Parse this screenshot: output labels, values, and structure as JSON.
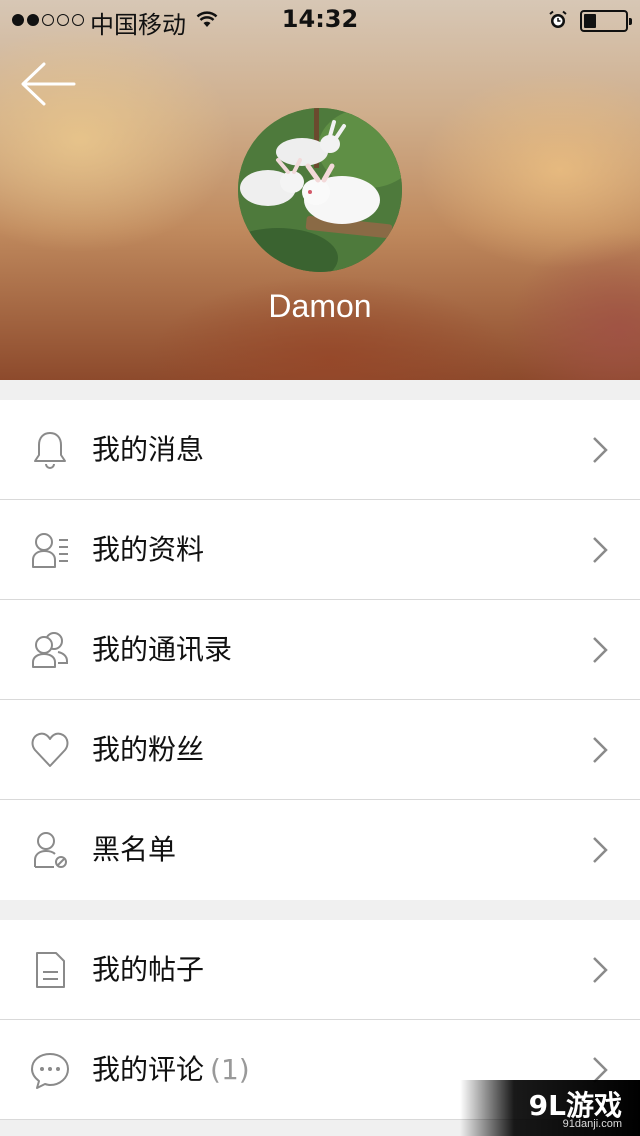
{
  "status_bar": {
    "signal_dots": [
      true,
      true,
      false,
      false,
      false
    ],
    "carrier": "中国移动",
    "time": "14:32",
    "battery_level": 0.3
  },
  "profile": {
    "username": "Damon"
  },
  "menu": {
    "group1": [
      {
        "label": "我的消息",
        "icon": "bell-icon"
      },
      {
        "label": "我的资料",
        "icon": "profile-card-icon"
      },
      {
        "label": "我的通讯录",
        "icon": "contacts-icon"
      },
      {
        "label": "我的粉丝",
        "icon": "heart-icon"
      },
      {
        "label": "黑名单",
        "icon": "blocked-user-icon"
      }
    ],
    "group2": [
      {
        "label": "我的帖子",
        "icon": "document-icon"
      },
      {
        "label": "我的评论",
        "count": "(1)",
        "icon": "chat-bubble-icon"
      }
    ]
  },
  "watermark": {
    "main": "9L游戏",
    "sub": "91danji.com"
  },
  "colors": {
    "icon_stroke": "#8a8a8a",
    "divider": "#d9d9d9",
    "background": "#f0f0f0"
  }
}
